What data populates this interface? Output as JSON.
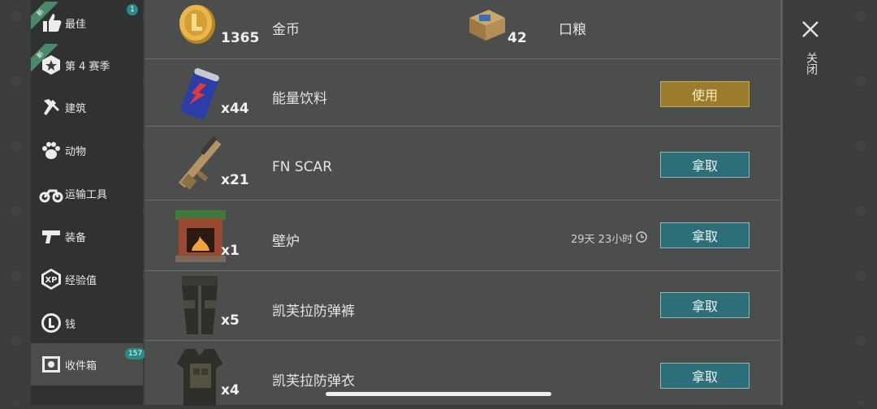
{
  "sidebar": {
    "items": [
      {
        "label": "最佳",
        "icon": "thumbs-up-icon",
        "new_tag": "新",
        "badge": "1"
      },
      {
        "label": "第 4 赛季",
        "icon": "season-badge-icon",
        "new_tag": "新"
      },
      {
        "label": "建筑",
        "icon": "hammer-wrench-icon"
      },
      {
        "label": "动物",
        "icon": "paw-icon"
      },
      {
        "label": "运输工具",
        "icon": "motorcycle-icon"
      },
      {
        "label": "装备",
        "icon": "pistol-icon"
      },
      {
        "label": "经验值",
        "icon": "xp-icon"
      },
      {
        "label": "钱",
        "icon": "coin-icon"
      },
      {
        "label": "收件箱",
        "icon": "inbox-safe-icon",
        "badge": "157",
        "active": true
      }
    ]
  },
  "currency": {
    "coins_value": "1365",
    "coins_label": "金币",
    "rations_value": "42",
    "rations_label": "口粮"
  },
  "items": [
    {
      "qty": "x44",
      "name": "能量饮料",
      "button": "使用",
      "button_type": "use",
      "icon": "energy-drink-icon"
    },
    {
      "qty": "x21",
      "name": "FN SCAR",
      "button": "拿取",
      "button_type": "take",
      "icon": "rifle-icon"
    },
    {
      "qty": "x1",
      "name": "壁炉",
      "button": "拿取",
      "button_type": "take",
      "timer": "29天 23小时",
      "icon": "fireplace-icon"
    },
    {
      "qty": "x5",
      "name": "凯芙拉防弹裤",
      "button": "拿取",
      "button_type": "take",
      "icon": "kevlar-pants-icon"
    },
    {
      "qty": "x4",
      "name": "凯芙拉防弹衣",
      "button": "拿取",
      "button_type": "take",
      "icon": "kevlar-vest-icon"
    }
  ],
  "close": {
    "label": "关闭"
  },
  "colors": {
    "take_button": "#2c6f78",
    "use_button": "#9a7c2c",
    "badge": "#2a8a8a"
  }
}
